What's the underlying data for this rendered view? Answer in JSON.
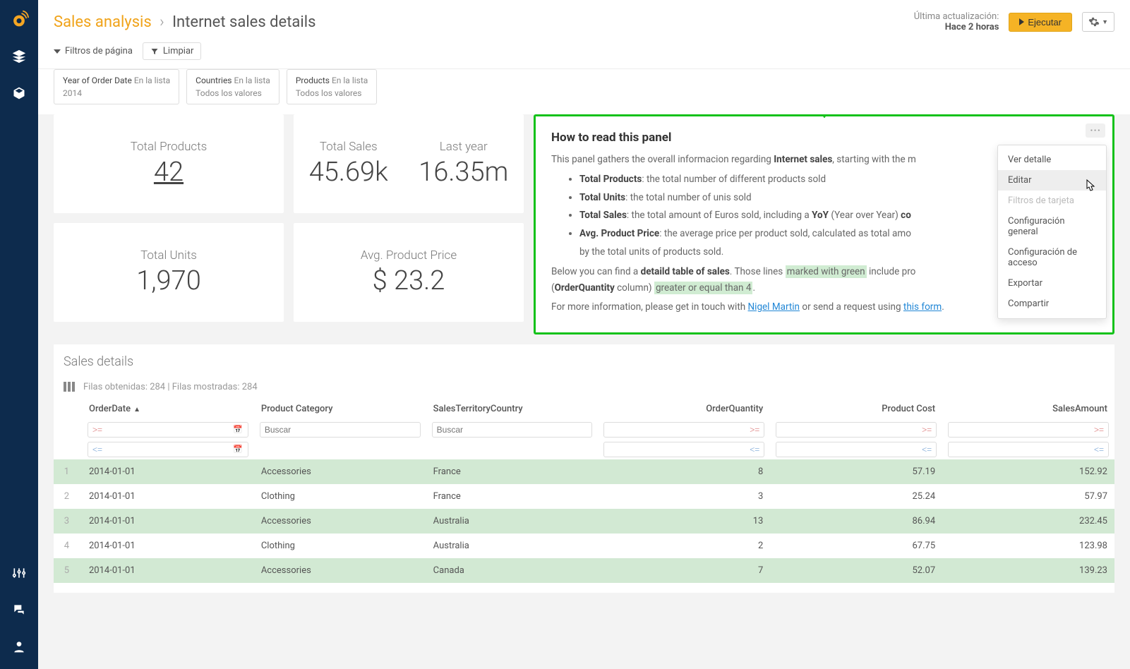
{
  "header": {
    "breadcrumb_lvl1": "Sales analysis",
    "breadcrumb_sep": "›",
    "breadcrumb_lvl2": "Internet sales details",
    "last_update_label": "Última actualización:",
    "last_update_value": "Hace 2 horas",
    "run_label": "Ejecutar"
  },
  "filters": {
    "toggle_label": "Filtros de página",
    "clear_label": "Limpiar",
    "pills": [
      {
        "name": "Year of Order Date",
        "line1": "En la lista",
        "line2": "2014"
      },
      {
        "name": "Countries",
        "line1": "En la lista",
        "line2": "Todos los valores"
      },
      {
        "name": "Products",
        "line1": "En la lista",
        "line2": "Todos los valores"
      }
    ]
  },
  "stats": {
    "total_products_lbl": "Total Products",
    "total_products_val": "42",
    "total_sales_lbl": "Total Sales",
    "total_sales_val": "45.69k",
    "last_year_lbl": "Last year",
    "last_year_val": "16.35m",
    "total_units_lbl": "Total Units",
    "total_units_val": "1,970",
    "avg_price_lbl": "Avg. Product Price",
    "avg_price_val": "$ 23.2"
  },
  "info": {
    "title": "How to read this panel",
    "p1_a": "This panel gathers the overall informacion regarding ",
    "p1_b": "Internet sales",
    "p1_c": ", starting with the m",
    "li1_b": "Total Products",
    "li1_t": ": the total number of different products sold",
    "li2_b": "Total Units",
    "li2_t": ": the total number of unis sold",
    "li3_b": "Total Sales",
    "li3_t1": ": the total amount of Euros sold, including a ",
    "li3_b2": "YoY",
    "li3_t2": " (Year over Year) ",
    "li3_b3": "co",
    "li4_b": "Avg. Product Price",
    "li4_t": ": the average price per product sold, calculated as total amo",
    "li4_t2": "by the total units of products sold.",
    "p2_a": "Below you can find a ",
    "p2_b": "detaild table of sales",
    "p2_c": ". Those lines ",
    "p2_hl1": "marked with green",
    "p2_d": " include pro",
    "p2_e": "(",
    "p2_b2": "OrderQuantity",
    "p2_f": " column) ",
    "p2_hl2": "greater or equal than 4",
    "p2_g": ".",
    "p3_a": "For more information, please get in touch with ",
    "p3_link1": "Nigel Martin",
    "p3_b": " or send a request using ",
    "p3_link2": "this form",
    "p3_c": "."
  },
  "ctx": {
    "m1": "Ver detalle",
    "m2": "Editar",
    "m3": "Filtros de tarjeta",
    "m4": "Configuración general",
    "m5": "Configuración de acceso",
    "m6": "Exportar",
    "m7": "Compartir"
  },
  "table": {
    "title": "Sales details",
    "meta": "Filas obtenidas: 284 | Filas mostradas: 284",
    "cols": {
      "c1": "OrderDate",
      "c2": "Product Category",
      "c3": "SalesTerritoryCountry",
      "c4": "OrderQuantity",
      "c5": "Product Cost",
      "c6": "SalesAmount"
    },
    "search_ph": "Buscar",
    "gte_ph": ">=",
    "lte_ph": "<=",
    "rows": [
      {
        "n": "1",
        "d": "2014-01-01",
        "cat": "Accessories",
        "cty": "France",
        "q": "8",
        "cost": "57.19",
        "amt": "152.92",
        "g": true
      },
      {
        "n": "2",
        "d": "2014-01-01",
        "cat": "Clothing",
        "cty": "France",
        "q": "3",
        "cost": "25.24",
        "amt": "57.97",
        "g": false
      },
      {
        "n": "3",
        "d": "2014-01-01",
        "cat": "Accessories",
        "cty": "Australia",
        "q": "13",
        "cost": "86.94",
        "amt": "232.45",
        "g": true
      },
      {
        "n": "4",
        "d": "2014-01-01",
        "cat": "Clothing",
        "cty": "Australia",
        "q": "2",
        "cost": "67.75",
        "amt": "123.98",
        "g": false
      },
      {
        "n": "5",
        "d": "2014-01-01",
        "cat": "Accessories",
        "cty": "Canada",
        "q": "7",
        "cost": "52.07",
        "amt": "139.23",
        "g": true
      }
    ]
  }
}
